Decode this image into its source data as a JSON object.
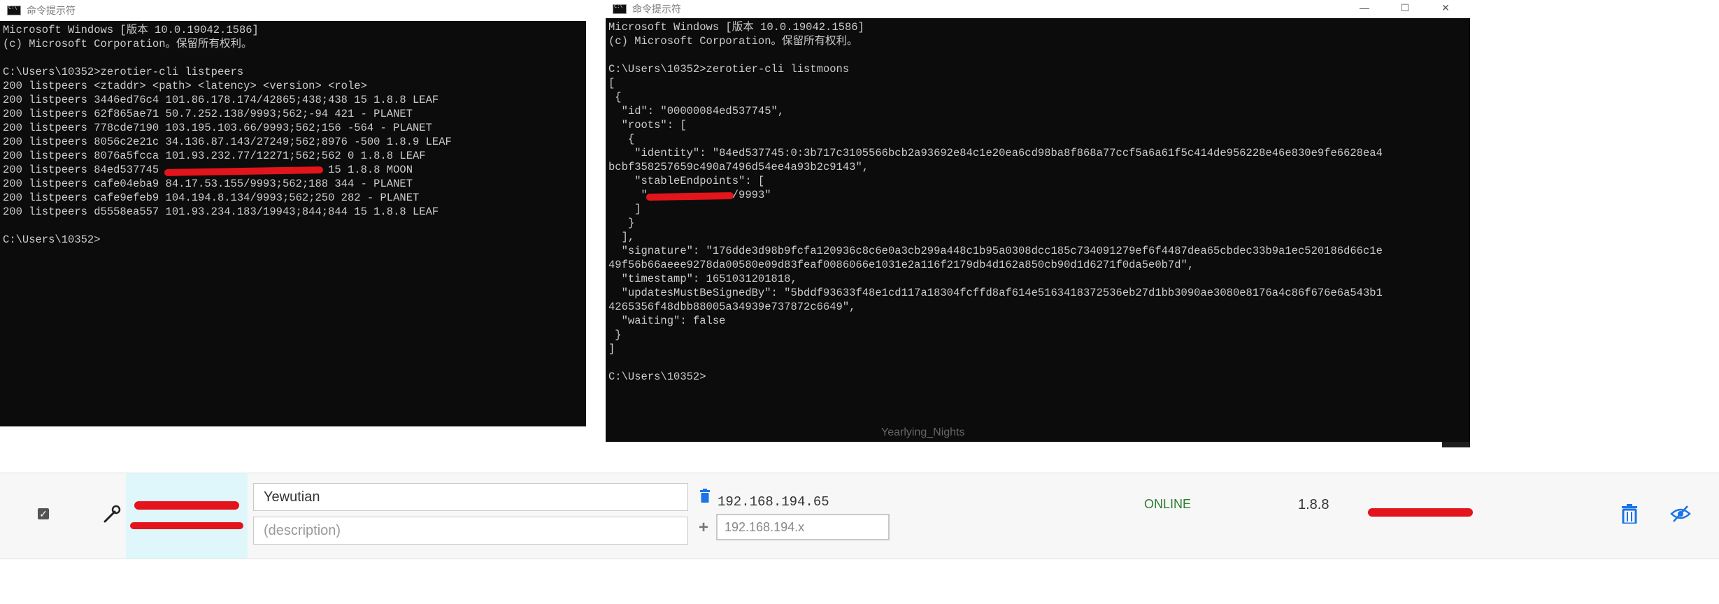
{
  "left_console": {
    "title": "命令提示符",
    "lines": [
      "Microsoft Windows [版本 10.0.19042.1586]",
      "(c) Microsoft Corporation。保留所有权利。",
      "",
      "C:\\Users\\10352>zerotier-cli listpeers",
      "200 listpeers <ztaddr> <path> <latency> <version> <role>",
      "200 listpeers 3446ed76c4 101.86.178.174/42865;438;438 15 1.8.8 LEAF",
      "200 listpeers 62f865ae71 50.7.252.138/9993;562;-94 421 - PLANET",
      "200 listpeers 778cde7190 103.195.103.66/9993;562;156 -564 - PLANET",
      "200 listpeers 8056c2e21c 34.136.87.143/27249;562;8976 -500 1.8.9 LEAF",
      "200 listpeers 8076a5fcca 101.93.232.77/12271;562;562 0 1.8.8 LEAF",
      "200 listpeers 84ed537745 ",
      "200 listpeers cafe04eba9 84.17.53.155/9993;562;188 344 - PLANET",
      "200 listpeers cafe9efeb9 104.194.8.134/9993;562;250 282 - PLANET",
      "200 listpeers d5558ea557 101.93.234.183/19943;844;844 15 1.8.8 LEAF",
      "",
      "C:\\Users\\10352>"
    ],
    "moon_line_tail": " 15 1.8.8 MOON"
  },
  "right_console": {
    "title": "命令提示符",
    "window_buttons": [
      "—",
      "☐",
      "✕"
    ],
    "lines": [
      "Microsoft Windows [版本 10.0.19042.1586]",
      "(c) Microsoft Corporation。保留所有权利。",
      "",
      "C:\\Users\\10352>zerotier-cli listmoons",
      "[",
      " {",
      "  \"id\": \"00000084ed537745\",",
      "  \"roots\": [",
      "   {",
      "    \"identity\": \"84ed537745:0:3b717c3105566bcb2a93692e84c1e20ea6cd98ba8f868a77ccf5a6a61f5c414de956228e46e830e9fe6628ea4",
      "bcbf358257659c490a7496d54ee4a93b2c9143\",",
      "    \"stableEndpoints\": [",
      "     \"",
      "    ]",
      "   }",
      "  ],",
      "  \"signature\": \"176dde3d98b9fcfa120936c8c6e0a3cb299a448c1b95a0308dcc185c734091279ef6f4487dea65cbdec33b9a1ec520186d66c1e",
      "49f56b66aeee9278da00580e09d83feaf0086066e1031e2a116f2179db4d162a850cb90d1d6271f0da5e0b7d\",",
      "  \"timestamp\": 1651031201818,",
      "  \"updatesMustBeSignedBy\": \"5bddf93633f48e1cd117a18304fcffd8af614e5163418372536eb27d1bb3090ae3080e8176a4c86f676e6a543b1",
      "4265356f48dbb88005a34939e737872c6649\",",
      "  \"waiting\": false",
      " }",
      "]",
      "",
      "C:\\Users\\10352>"
    ],
    "endpoint_tail": "/9993\""
  },
  "behind_text": "Yearlying_Nights",
  "member": {
    "authorized": true,
    "name": "Yewutian",
    "description_placeholder": "(description)",
    "managed_ip": "192.168.194.65",
    "ip_placeholder": "192.168.194.x",
    "status": "ONLINE",
    "version": "1.8.8",
    "icons": {
      "bridge": "wrench-icon",
      "ip_delete": "trash-icon",
      "add_ip": "plus-icon",
      "delete": "trash-icon",
      "hide": "eye-slash-icon"
    }
  },
  "colors": {
    "console_bg": "#0c0c0c",
    "console_text": "#cccccc",
    "accent_blue": "#1a73e8",
    "status_green": "#2e7d32",
    "redaction": "#e3141b"
  }
}
